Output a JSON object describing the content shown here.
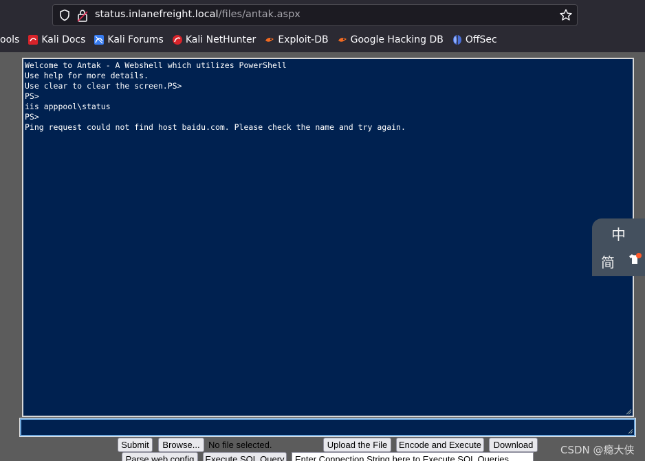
{
  "browser": {
    "url_host": "status.inlanefreight.local",
    "url_path": "/files/antak.aspx",
    "bookmarks": [
      {
        "label": "ools",
        "icon": "bookmark-tools-icon"
      },
      {
        "label": "Kali Docs",
        "icon": "kali-docs-icon"
      },
      {
        "label": "Kali Forums",
        "icon": "kali-forums-icon"
      },
      {
        "label": "Kali NetHunter",
        "icon": "kali-nethunter-icon"
      },
      {
        "label": "Exploit-DB",
        "icon": "exploit-db-icon"
      },
      {
        "label": "Google Hacking DB",
        "icon": "google-hacking-db-icon"
      },
      {
        "label": "OffSec",
        "icon": "offsec-icon"
      }
    ]
  },
  "console": {
    "output": "Welcome to Antak - A Webshell which utilizes PowerShell\nUse help for more details.\nUse clear to clear the screen.PS>\nPS>\niis apppool\\status\nPS>\nPing request could not find host baidu.com. Please check the name and try again."
  },
  "controls": {
    "submit": "Submit",
    "browse": "Browse...",
    "no_file": "No file selected.",
    "upload": "Upload the File",
    "encode_execute": "Encode and Execute",
    "download": "Download",
    "parse_web_config": "Parse web.config",
    "execute_sql": "Execute SQL Query",
    "connection_string_placeholder": "Enter Connection String here to Execute SQL Queries"
  },
  "ime": {
    "mode": "中",
    "script": "简"
  },
  "watermark": "CSDN @瘾大侠",
  "colors": {
    "console_bg": "#002150",
    "page_bg": "#5c5c5c",
    "chrome_bg": "#2b2a33"
  }
}
